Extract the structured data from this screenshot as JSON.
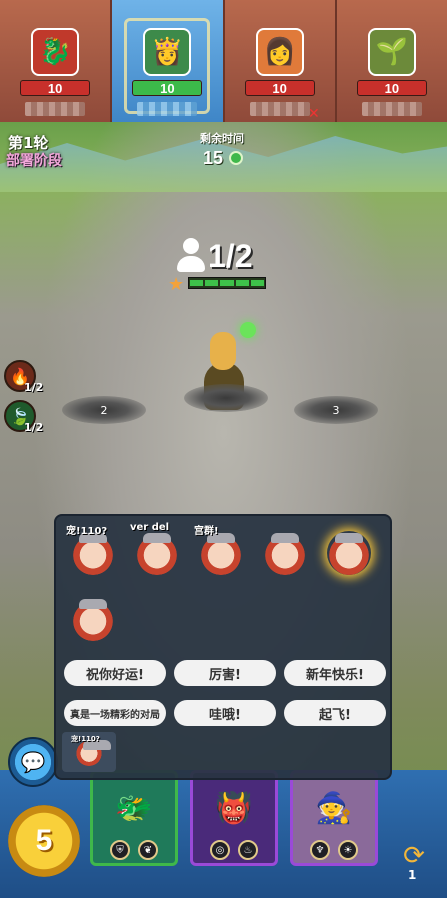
{
  "players": [
    {
      "hp": "10",
      "portrait": "red-dragon-portrait",
      "active": false
    },
    {
      "hp": "10",
      "portrait": "elf-queen-portrait",
      "active": true
    },
    {
      "hp": "10",
      "portrait": "redhead-warrior-portrait",
      "active": false
    },
    {
      "hp": "10",
      "portrait": "plant-creature-portrait",
      "active": false
    }
  ],
  "round": {
    "label": "第1轮",
    "phase": "部署阶段"
  },
  "timer": {
    "label": "剩余时间",
    "value": "15"
  },
  "population": {
    "value": "1/2"
  },
  "deploy_slots": [
    "2",
    "3"
  ],
  "side_skills": [
    {
      "icon": "fire-claw-icon",
      "count": "1/2",
      "color": "#6b2a1a"
    },
    {
      "icon": "leaf-icon",
      "count": "1/2",
      "color": "#1f5a2c"
    }
  ],
  "emote_panel": {
    "stickers": [
      {
        "caption": "宠!110?",
        "glow": false
      },
      {
        "caption": "ver del",
        "glow": false
      },
      {
        "caption": "宫群!",
        "glow": false
      },
      {
        "caption": "",
        "glow": false
      },
      {
        "caption": "",
        "glow": true
      },
      {
        "caption": "",
        "glow": false
      }
    ],
    "phrases_row1": [
      "祝你好运!",
      "厉害!",
      "新年快乐!"
    ],
    "phrases_row2": [
      "真是一场精彩的对局",
      "哇哦!",
      "起飞!"
    ],
    "recent_caption": "宠!110?"
  },
  "gold": "5",
  "refresh": {
    "count": "1"
  },
  "shop_cards": [
    {
      "border": "#3fb84a",
      "art_bg": "#1f7a5a",
      "traits": [
        "shield-icon",
        "leaf-icon"
      ]
    },
    {
      "border": "#9a4ad8",
      "art_bg": "#4a2a7a",
      "traits": [
        "swirl-icon",
        "fire-icon"
      ]
    },
    {
      "border": "#9a4ad8",
      "art_bg": "#8a6a9a",
      "traits": [
        "demon-icon",
        "sun-icon"
      ]
    }
  ]
}
